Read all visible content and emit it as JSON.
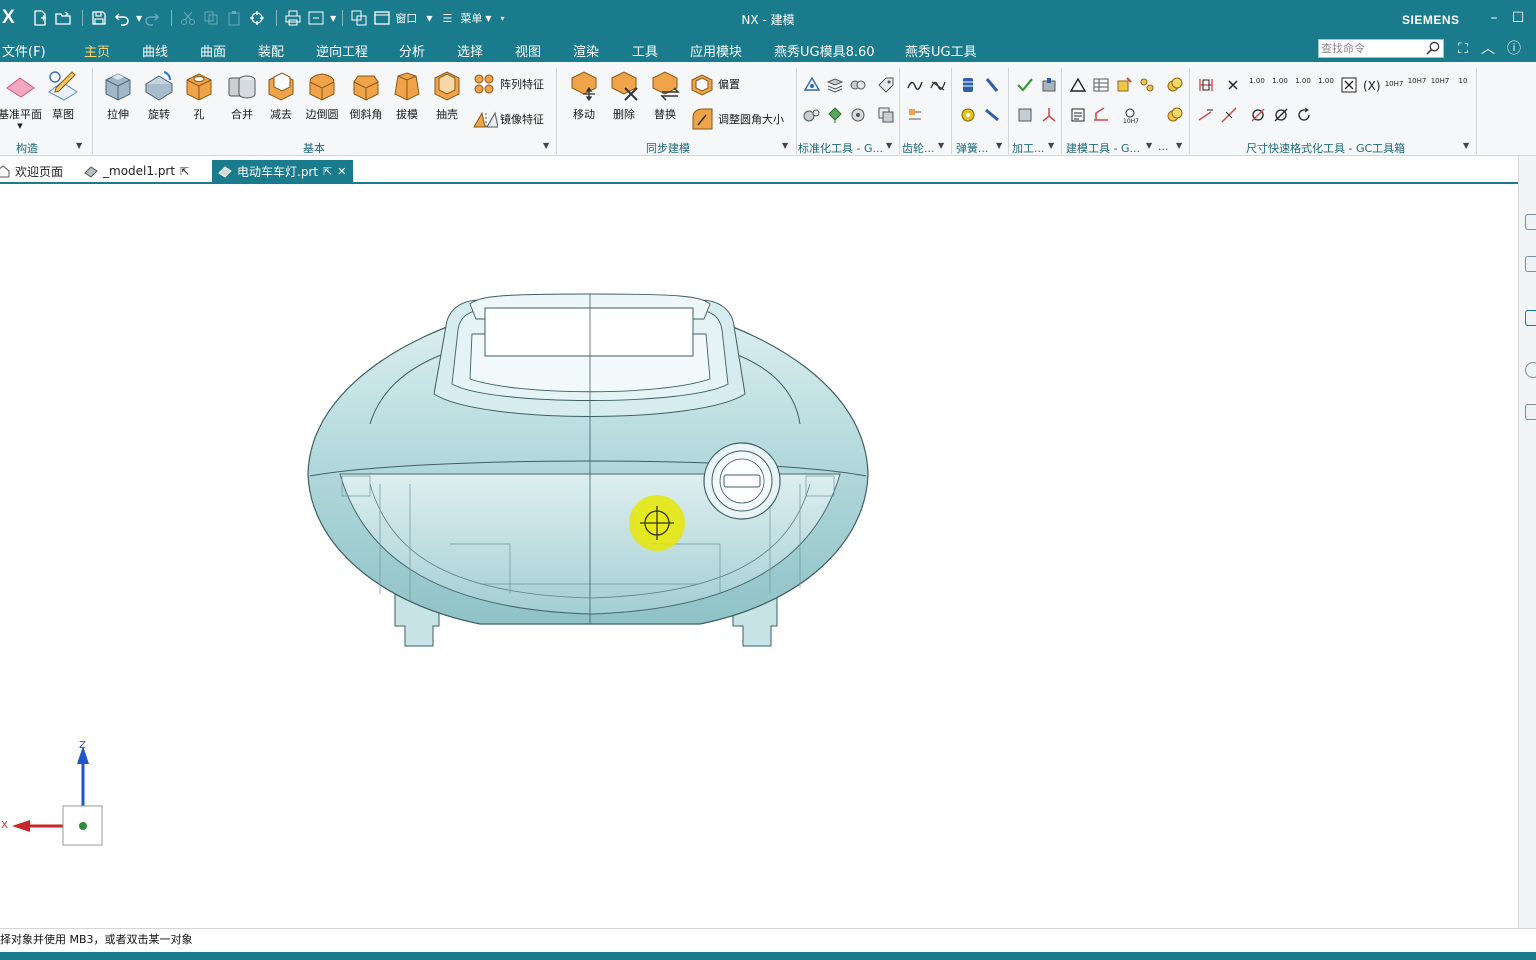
{
  "app": {
    "logo": "X",
    "title": "NX - 建模",
    "brand": "SIEMENS",
    "window_menu": "窗口",
    "menu_label": "菜单"
  },
  "menu_tabs": [
    "文件(F)",
    "主页",
    "曲线",
    "曲面",
    "装配",
    "逆向工程",
    "分析",
    "选择",
    "视图",
    "渲染",
    "工具",
    "应用模块",
    "燕秀UG模具8.60",
    "燕秀UG工具"
  ],
  "active_tab": "主页",
  "search": {
    "placeholder": "查找命令"
  },
  "ribbon": {
    "construct": {
      "datum_plane": "基准平面",
      "sketch": "草图",
      "group": "构造"
    },
    "basic": {
      "buttons": [
        "拉伸",
        "旋转",
        "孔",
        "合并",
        "减去",
        "边倒圆",
        "倒斜角",
        "拔模",
        "抽壳"
      ],
      "pattern_feature": "阵列特征",
      "mirror_feature": "镜像特征",
      "group": "基本"
    },
    "sync": {
      "buttons": [
        "移动",
        "删除",
        "替换"
      ],
      "offset": "偏置",
      "resize_blend": "调整圆角大小",
      "group": "同步建模"
    },
    "groups_small": [
      "标准化工具 - G...",
      "齿轮...",
      "弹簧...",
      "加工...",
      "建模工具 - G...",
      "...",
      "尺寸快速格式化工具 - GC工具箱"
    ],
    "dim_labels": [
      "1.00",
      "1.00",
      "1.00",
      "1.00",
      "10H7",
      "10H7",
      "10H7",
      "10"
    ]
  },
  "doc_tabs": [
    {
      "label": "欢迎页面",
      "active": false
    },
    {
      "label": "_model1.prt",
      "active": false
    },
    {
      "label": "电动车车灯.prt",
      "active": true
    }
  ],
  "triad": {
    "z": "Z",
    "x": "X"
  },
  "status": "择对象并使用 MB3，或者双击某一对象",
  "colors": {
    "chrome": "#1a7b8d",
    "active_tab_text": "#ffd66b",
    "model_fill": "#bfe0e3",
    "cursor_highlight": "#e6e600"
  }
}
